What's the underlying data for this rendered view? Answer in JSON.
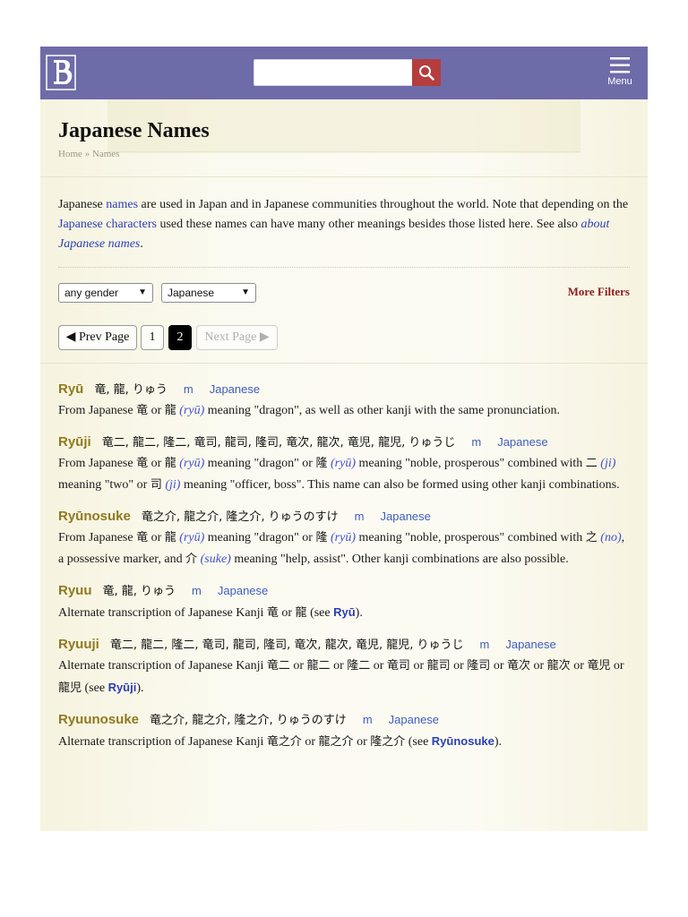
{
  "header": {
    "menu_label": "Menu",
    "search_placeholder": ""
  },
  "page": {
    "title": "Japanese Names",
    "breadcrumb": [
      "Home",
      "Names"
    ],
    "breadcrumb_sep": "»"
  },
  "intro": {
    "p1": "Japanese ",
    "link_names": "names",
    "p2": " are used in Japan and in Japanese communities throughout the world. Note that depending on the ",
    "link_chars": "Japanese characters",
    "p3": " used these names can have many other meanings besides those listed here. See also ",
    "link_about": "about Japanese names",
    "p4": "."
  },
  "filters": {
    "gender": "any gender",
    "usage": "Japanese",
    "more": "More Filters"
  },
  "pager": {
    "prev": "◀ Prev Page",
    "page1": "1",
    "page2": "2",
    "next": "Next Page ▶"
  },
  "entries": [
    {
      "name": "Ryū",
      "kanji": "竜, 龍, りゅう",
      "gender": "m",
      "usage": "Japanese",
      "desc": [
        {
          "t": "From Japanese "
        },
        {
          "k": "竜"
        },
        {
          "t": " or "
        },
        {
          "k": "龍"
        },
        {
          "t": " "
        },
        {
          "tr": "(ryū)"
        },
        {
          "t": " meaning \"dragon\", as well as other kanji with the same pronunciation."
        }
      ]
    },
    {
      "name": "Ryūji",
      "kanji": "竜二, 龍二, 隆二, 竜司, 龍司, 隆司, 竜次, 龍次, 竜児, 龍児, りゅうじ",
      "gender": "m",
      "usage": "Japanese",
      "desc": [
        {
          "t": "From Japanese "
        },
        {
          "k": "竜"
        },
        {
          "t": " or "
        },
        {
          "k": "龍"
        },
        {
          "t": " "
        },
        {
          "tr": "(ryū)"
        },
        {
          "t": " meaning \"dragon\" or "
        },
        {
          "k": "隆"
        },
        {
          "t": " "
        },
        {
          "tr": "(ryū)"
        },
        {
          "t": " meaning \"noble, prosperous\" combined with "
        },
        {
          "k": "二"
        },
        {
          "t": " "
        },
        {
          "tr": "(ji)"
        },
        {
          "t": " meaning \"two\" or "
        },
        {
          "k": "司"
        },
        {
          "t": " "
        },
        {
          "tr": "(ji)"
        },
        {
          "t": " meaning \"officer, boss\". This name can also be formed using other kanji combinations."
        }
      ]
    },
    {
      "name": "Ryūnosuke",
      "kanji": "竜之介, 龍之介, 隆之介, りゅうのすけ",
      "gender": "m",
      "usage": "Japanese",
      "desc": [
        {
          "t": "From Japanese "
        },
        {
          "k": "竜"
        },
        {
          "t": " or "
        },
        {
          "k": "龍"
        },
        {
          "t": " "
        },
        {
          "tr": "(ryū)"
        },
        {
          "t": " meaning \"dragon\" or "
        },
        {
          "k": "隆"
        },
        {
          "t": " "
        },
        {
          "tr": "(ryū)"
        },
        {
          "t": " meaning \"noble, prosperous\" combined with "
        },
        {
          "k": "之"
        },
        {
          "t": " "
        },
        {
          "tr": "(no)"
        },
        {
          "t": ", a possessive marker, and "
        },
        {
          "k": "介"
        },
        {
          "t": " "
        },
        {
          "tr": "(suke)"
        },
        {
          "t": " meaning \"help, assist\". Other kanji combinations are also possible."
        }
      ]
    },
    {
      "name": "Ryuu",
      "kanji": "竜, 龍, りゅう",
      "gender": "m",
      "usage": "Japanese",
      "desc": [
        {
          "t": "Alternate transcription of Japanese Kanji "
        },
        {
          "k": "竜"
        },
        {
          "t": " or "
        },
        {
          "k": "龍"
        },
        {
          "t": " (see "
        },
        {
          "ref": "Ryū"
        },
        {
          "t": ")."
        }
      ]
    },
    {
      "name": "Ryuuji",
      "kanji": "竜二, 龍二, 隆二, 竜司, 龍司, 隆司, 竜次, 龍次, 竜児, 龍児, りゅうじ",
      "gender": "m",
      "usage": "Japanese",
      "desc": [
        {
          "t": "Alternate transcription of Japanese Kanji "
        },
        {
          "k": "竜二"
        },
        {
          "t": " or "
        },
        {
          "k": "龍二"
        },
        {
          "t": " or "
        },
        {
          "k": "隆二"
        },
        {
          "t": " or "
        },
        {
          "k": "竜司"
        },
        {
          "t": " or "
        },
        {
          "k": "龍司"
        },
        {
          "t": " or "
        },
        {
          "k": "隆司"
        },
        {
          "t": " or "
        },
        {
          "k": "竜次"
        },
        {
          "t": " or "
        },
        {
          "k": "龍次"
        },
        {
          "t": " or "
        },
        {
          "k": "竜児"
        },
        {
          "t": " or "
        },
        {
          "k": "龍児"
        },
        {
          "t": " (see "
        },
        {
          "ref": "Ryūji"
        },
        {
          "t": ")."
        }
      ]
    },
    {
      "name": "Ryuunosuke",
      "kanji": "竜之介, 龍之介, 隆之介, りゅうのすけ",
      "gender": "m",
      "usage": "Japanese",
      "desc": [
        {
          "t": "Alternate transcription of Japanese Kanji "
        },
        {
          "k": "竜之介"
        },
        {
          "t": " or "
        },
        {
          "k": "龍之介"
        },
        {
          "t": " or "
        },
        {
          "k": "隆之介"
        },
        {
          "t": " (see "
        },
        {
          "ref": "Ryūnosuke"
        },
        {
          "t": ")."
        }
      ]
    }
  ],
  "colors": {
    "header": "#6e6ba9",
    "search_button": "#b53d3d",
    "name": "#8f7a1e",
    "link": "#2a3fb5",
    "more_filters": "#8b1f1f"
  }
}
